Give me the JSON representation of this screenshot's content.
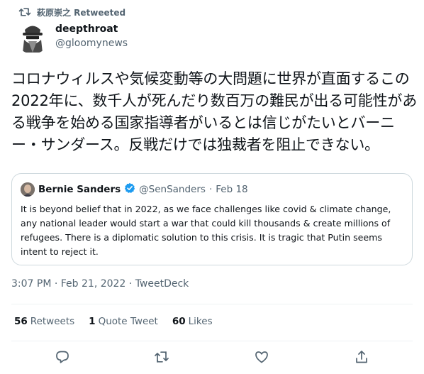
{
  "retweet": {
    "label": "萩原崇之 Retweeted",
    "icon": "retweet-icon"
  },
  "author": {
    "display_name": "deepthroat",
    "handle": "@gloomynews",
    "avatar_icon": "spy-avatar-icon"
  },
  "tweet": {
    "text": "コロナウィルスや気候変動等の大問題に世界が直面するこの2022年に、数千人が死んだり数百万の難民が出る可能性がある戦争を始める国家指導者がいるとは信じがたいとバーニー・サンダース。反戦だけでは独裁者を阻止できない。"
  },
  "quote": {
    "display_name": "Bernie Sanders",
    "verified_icon": "verified-badge-icon",
    "handle": "@SenSanders",
    "separator": "·",
    "date": "Feb 18",
    "text": "It is beyond belief that in 2022, as we face challenges like covid & climate change, any national leader would start a war that could kill thousands & create millions of refugees. There is a diplomatic solution to this crisis. It is tragic that Putin seems intent to reject it."
  },
  "meta": {
    "timestamp": "3:07 PM · Feb 21, 2022 · TweetDeck"
  },
  "stats": {
    "retweets_count": "56",
    "retweets_label": "Retweets",
    "quotes_count": "1",
    "quotes_label": "Quote Tweet",
    "likes_count": "60",
    "likes_label": "Likes"
  },
  "actions": [
    "reply-icon",
    "retweet-icon",
    "like-icon",
    "share-icon"
  ],
  "colors": {
    "text": "#0f1419",
    "secondary": "#536471",
    "verified": "#1d9bf0",
    "border": "#cfd9de"
  }
}
